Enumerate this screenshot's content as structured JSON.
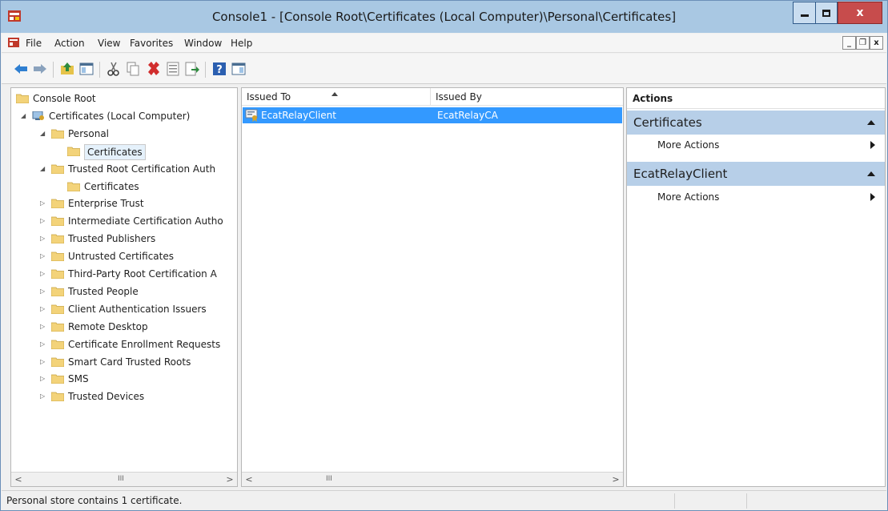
{
  "window": {
    "title": "Console1 - [Console Root\\Certificates (Local Computer)\\Personal\\Certificates]",
    "close_glyph": "x"
  },
  "menu": {
    "items": [
      "File",
      "Action",
      "View",
      "Favorites",
      "Window",
      "Help"
    ]
  },
  "mdi_buttons": [
    "_",
    "❐",
    "x"
  ],
  "tree": {
    "nodes": [
      {
        "label": "Console Root",
        "depth": 0,
        "expander": "none"
      },
      {
        "label": "Certificates (Local Computer)",
        "depth": 1,
        "expander": "expanded"
      },
      {
        "label": "Personal",
        "depth": 2,
        "expander": "expanded"
      },
      {
        "label": "Certificates",
        "depth": 3,
        "expander": "none",
        "selected": true
      },
      {
        "label": "Trusted Root Certification Auth",
        "depth": 2,
        "expander": "expanded"
      },
      {
        "label": "Certificates",
        "depth": 3,
        "expander": "none"
      },
      {
        "label": "Enterprise Trust",
        "depth": 2,
        "expander": "collapsed"
      },
      {
        "label": "Intermediate Certification Autho",
        "depth": 2,
        "expander": "collapsed"
      },
      {
        "label": "Trusted Publishers",
        "depth": 2,
        "expander": "collapsed"
      },
      {
        "label": "Untrusted Certificates",
        "depth": 2,
        "expander": "collapsed"
      },
      {
        "label": "Third-Party Root Certification A",
        "depth": 2,
        "expander": "collapsed"
      },
      {
        "label": "Trusted People",
        "depth": 2,
        "expander": "collapsed"
      },
      {
        "label": "Client Authentication Issuers",
        "depth": 2,
        "expander": "collapsed"
      },
      {
        "label": "Remote Desktop",
        "depth": 2,
        "expander": "collapsed"
      },
      {
        "label": "Certificate Enrollment Requests",
        "depth": 2,
        "expander": "collapsed"
      },
      {
        "label": "Smart Card Trusted Roots",
        "depth": 2,
        "expander": "collapsed"
      },
      {
        "label": "SMS",
        "depth": 2,
        "expander": "collapsed"
      },
      {
        "label": "Trusted Devices",
        "depth": 2,
        "expander": "collapsed"
      }
    ]
  },
  "list": {
    "columns": [
      "Issued To",
      "Issued By"
    ],
    "rows": [
      {
        "issued_to": "EcatRelayClient",
        "issued_by": "EcatRelayCA",
        "selected": true
      }
    ]
  },
  "scroll": {
    "left": "<",
    "right": ">",
    "thumb": "III"
  },
  "actions": {
    "title": "Actions",
    "sections": [
      {
        "name": "Certificates",
        "items": [
          "More Actions"
        ]
      },
      {
        "name": "EcatRelayClient",
        "items": [
          "More Actions"
        ]
      }
    ]
  },
  "status": {
    "text": "Personal store contains 1 certificate."
  },
  "colors": {
    "titlebar": "#a9c8e3",
    "selection": "#3399ff",
    "section_header": "#b7cfe8",
    "close_button": "#c74c4c"
  }
}
